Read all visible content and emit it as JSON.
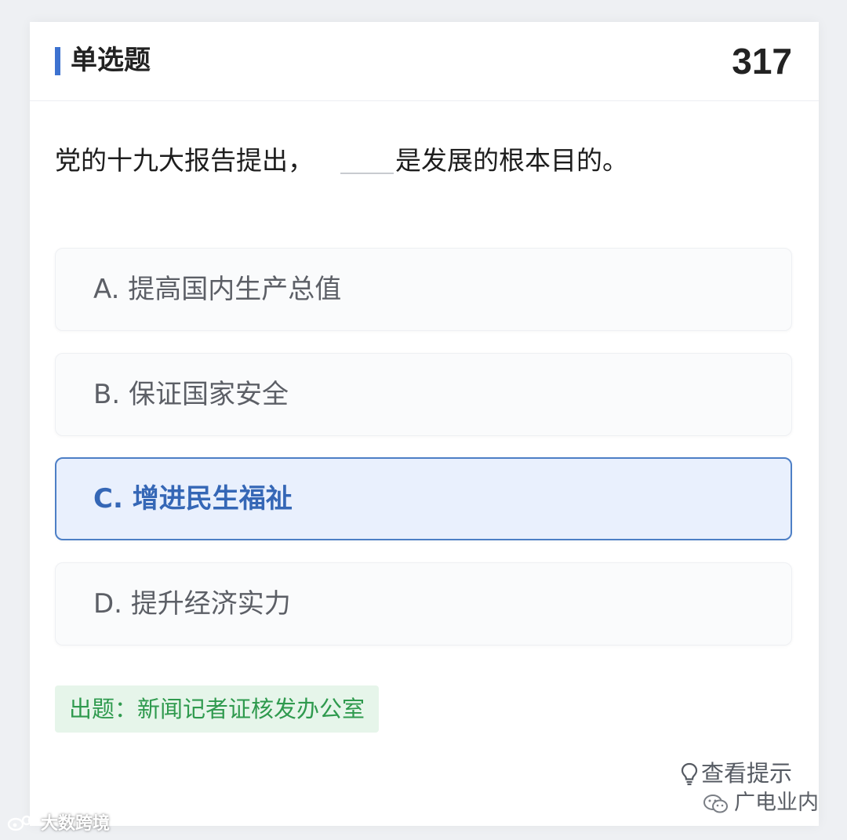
{
  "header": {
    "question_type": "单选题",
    "question_number": "317"
  },
  "question": {
    "stem_before": "党的十九大报告提出，",
    "stem_after": "是发展的根本目的。"
  },
  "options": [
    {
      "letter": "A.",
      "text": "提高国内生产总值",
      "selected": false
    },
    {
      "letter": "B.",
      "text": "保证国家安全",
      "selected": false
    },
    {
      "letter": "C.",
      "text": "增进民生福祉",
      "selected": true
    },
    {
      "letter": "D.",
      "text": "提升经济实力",
      "selected": false
    }
  ],
  "source_label": "出题：新闻记者证核发办公室",
  "hint_label": "查看提示",
  "watermarks": {
    "left": "大数跨境",
    "right": "广电业内"
  },
  "colors": {
    "accent": "#3d72d0",
    "selected_bg": "#e9f0fd",
    "selected_border": "#4d7fc6",
    "selected_text": "#3567b6",
    "source_bg": "#e6f5ea",
    "source_text": "#2f9a4e"
  },
  "icons": {
    "hint": "lightbulb-icon",
    "wechat": "wechat-icon",
    "weibo": "weibo-icon"
  }
}
